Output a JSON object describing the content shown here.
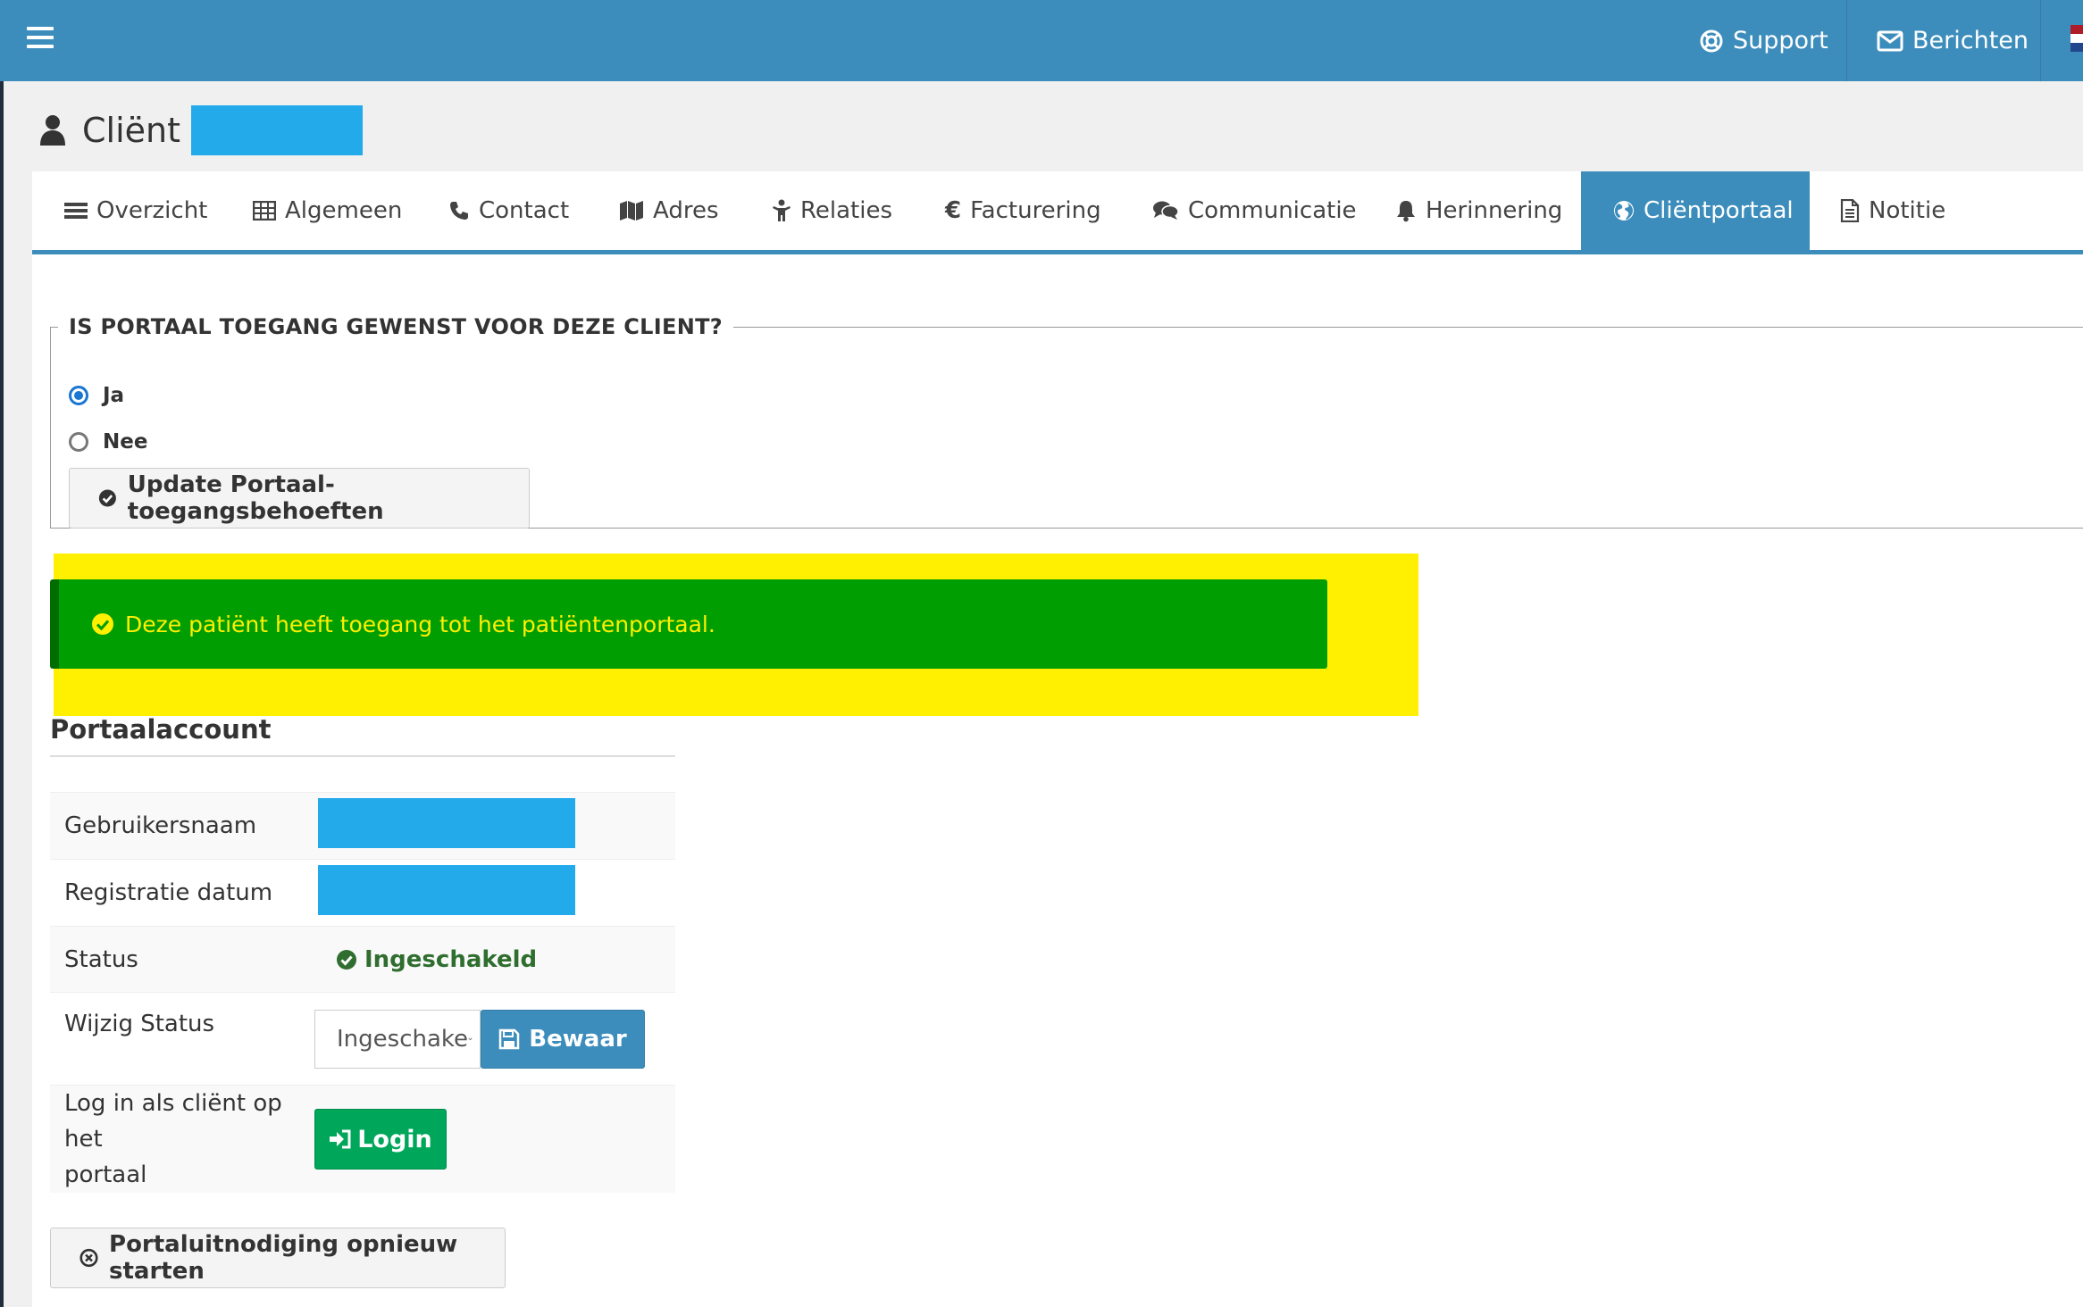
{
  "topbar": {
    "support_label": "Support",
    "messages_label": "Berichten"
  },
  "header": {
    "title": "Cliënt"
  },
  "tabs": [
    {
      "label": "Overzicht",
      "icon": "bars-icon"
    },
    {
      "label": "Algemeen",
      "icon": "table-icon"
    },
    {
      "label": "Contact",
      "icon": "phone-icon"
    },
    {
      "label": "Adres",
      "icon": "map-icon"
    },
    {
      "label": "Relaties",
      "icon": "child-icon"
    },
    {
      "label": "Facturering",
      "icon": "euro-icon"
    },
    {
      "label": "Communicatie",
      "icon": "comments-icon"
    },
    {
      "label": "Herinnering",
      "icon": "bell-icon"
    },
    {
      "label": "Cliëntportaal",
      "icon": "globe-icon",
      "active": true
    },
    {
      "label": "Notitie",
      "icon": "file-text-icon"
    }
  ],
  "portal_access": {
    "legend": "IS PORTAAL TOEGANG GEWENST VOOR DEZE CLIENT?",
    "options": [
      {
        "label": "Ja",
        "checked": true
      },
      {
        "label": "Nee",
        "checked": false
      }
    ],
    "update_button": "Update Portaal-toegangsbehoeften"
  },
  "alert": {
    "text": "Deze patiënt heeft toegang tot het patiëntenportaal."
  },
  "account": {
    "section_title": "Portaalaccount",
    "rows": {
      "username_label": "Gebruikersnaam",
      "registration_label": "Registratie datum",
      "status_label": "Status",
      "status_value": "Ingeschakeld",
      "change_status_label": "Wijzig Status",
      "select_value": "Ingeschake",
      "save_button": "Bewaar",
      "login_as_label_line1": "Log in als cliënt op het",
      "login_as_label_line2": "portaal",
      "login_button": "Login"
    },
    "restart_button": "Portaluitnodiging opnieuw starten"
  },
  "colors": {
    "brand": "#3c8dbc",
    "success": "#00a65a",
    "alert_bg": "#009e00",
    "highlight": "#ffef00",
    "redaction": "#22aaeb"
  }
}
